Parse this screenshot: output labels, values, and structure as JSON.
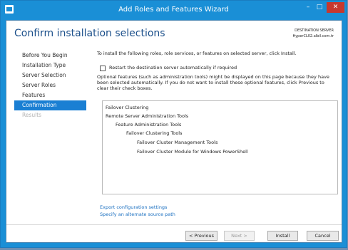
{
  "window": {
    "title": "Add Roles and Features Wizard",
    "controls": {
      "minimize": "–",
      "maximize": "□",
      "close": "✕"
    }
  },
  "header": {
    "heading": "Confirm installation selections",
    "destination_label": "DESTINATION SERVER",
    "destination_server": "HyperCL02.albil.com.tr"
  },
  "nav": {
    "items": [
      {
        "label": "Before You Begin",
        "state": "normal"
      },
      {
        "label": "Installation Type",
        "state": "normal"
      },
      {
        "label": "Server Selection",
        "state": "normal"
      },
      {
        "label": "Server Roles",
        "state": "normal"
      },
      {
        "label": "Features",
        "state": "normal"
      },
      {
        "label": "Confirmation",
        "state": "active"
      },
      {
        "label": "Results",
        "state": "disabled"
      }
    ]
  },
  "content": {
    "intro": "To install the following roles, role services, or features on selected server, click Install.",
    "restart_label": "Restart the destination server automatically if required",
    "restart_checked": false,
    "optional_note": "Optional features (such as administration tools) might be displayed on this page because they have been selected automatically. If you do not want to install these optional features, click Previous to clear their check boxes.",
    "selections": [
      {
        "label": "Failover Clustering",
        "level": 0
      },
      {
        "label": "Remote Server Administration Tools",
        "level": 0
      },
      {
        "label": "Feature Administration Tools",
        "level": 1
      },
      {
        "label": "Failover Clustering Tools",
        "level": 2
      },
      {
        "label": "Failover Cluster Management Tools",
        "level": 3
      },
      {
        "label": "Failover Cluster Module for Windows PowerShell",
        "level": 3
      }
    ],
    "links": {
      "export": "Export configuration settings",
      "alternate_source": "Specify an alternate source path"
    }
  },
  "buttons": {
    "previous": "< Previous",
    "next": "Next >",
    "install": "Install",
    "cancel": "Cancel"
  }
}
